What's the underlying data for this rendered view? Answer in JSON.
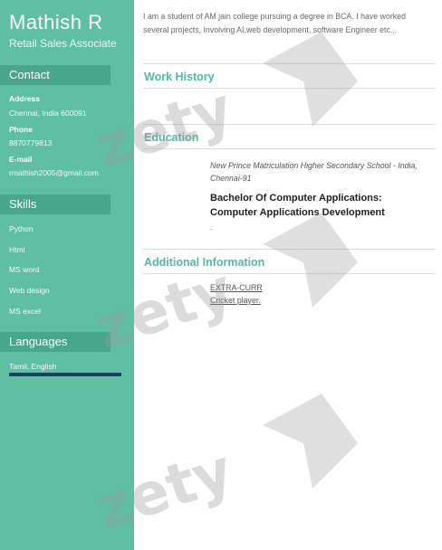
{
  "sidebar": {
    "name": "Mathish R",
    "role": "Retail Sales Associate",
    "contact": {
      "heading": "Contact",
      "address_label": "Address",
      "address_value": "Chennai, India 600091",
      "phone_label": "Phone",
      "phone_value": "8870779813",
      "email_label": "E-mail",
      "email_value": "rmathish2005@gmail.com"
    },
    "skills": {
      "heading": "Skills",
      "items": [
        "Python",
        "Html",
        "MS word",
        "Web design",
        "MS excel"
      ]
    },
    "languages": {
      "heading": "Languages",
      "value": "Tamil, English",
      "level": 1.0
    }
  },
  "main": {
    "summary": "I am a student of AM jain college pursuing a degree in BCA. I have worked several projects, Involving AI,web development, software Engineer etc...",
    "work_history": {
      "heading": "Work History"
    },
    "education": {
      "heading": "Education",
      "school": "New Prince Matriculation Higher Secondary School - India, Chennai-91",
      "degree": "Bachelor Of Computer Applications: Computer Applications Development",
      "dot": "."
    },
    "additional": {
      "heading": "Additional Information",
      "lines": [
        "EXTRA-CURR",
        "Cricket player."
      ]
    }
  },
  "watermark": {
    "text": "zety"
  },
  "colors": {
    "sidebar": "#5ebfa3",
    "section_bar": "#48a68b",
    "accent": "#55b8a0",
    "language_bar": "#1d3f67"
  }
}
